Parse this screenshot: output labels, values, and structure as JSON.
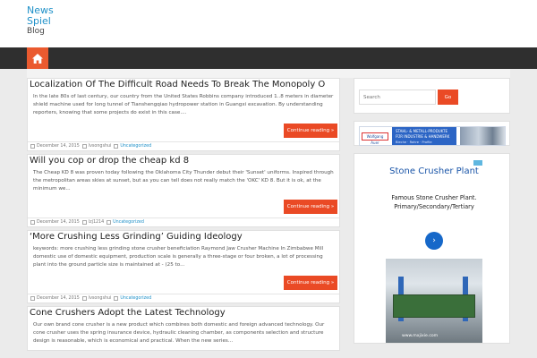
{
  "site": {
    "title_line1": "News",
    "title_line2": "Spiel",
    "tagline": "Blog"
  },
  "colors": {
    "accent": "#ea4a25",
    "link": "#1e90c8",
    "nav_bg": "#2f2f2f",
    "page_bg": "#ebebeb"
  },
  "nav": {
    "home_icon": "home-icon"
  },
  "posts": [
    {
      "title": "Localization Of The Difficult Road Needs To Break The Monopoly O",
      "excerpt": "In the late 80s of last century, our country from the United States Robbins company introduced 1..8 meters in diameter shield machine used for long tunnel of Tianshengqiao hydropower station in Guangxi excavation. By understanding reporters, knowing that some projects do exist in this case....",
      "read_more": "Continue reading »",
      "date": "December 14, 2015",
      "author": "lvsongshui",
      "category": "Uncategorized"
    },
    {
      "title": "Will you cop or drop the cheap kd 8",
      "excerpt": "The Cheap KD 8 was proven today following the Oklahoma City Thunder debut their 'Sunset' uniforms. Inspired through the metropolitan areas skies at sunset, but as you can tell does not really match the 'OKC' KD 8. But it is ok, at the minimum we...",
      "read_more": "Continue reading »",
      "date": "December 14, 2015",
      "author": "lzj1214",
      "category": "Uncategorized"
    },
    {
      "title": "‘More Crushing Less Grinding’ Guiding Ideology",
      "excerpt": "keywords: more crushing less grinding stone crusher beneficiation Raymond Jaw Crusher Machine In Zimbabwe Mill domestic use of domestic equipment, production scale is generally a three-stage or four broken, a lot of processing plant into the ground particle size is maintained at - (25 to...",
      "read_more": "Continue reading »",
      "date": "December 14, 2015",
      "author": "lvsongshui",
      "category": "Uncategorized"
    },
    {
      "title": "Cone Crushers Adopt the Latest Technology",
      "excerpt": "Our own brand cone crusher is a new product which combines both domestic and foreign advanced technology. Our cone crusher uses the spring insurance device, hydraulic cleaning chamber, as components selection and structure design is reasonable, which is economical and practical. When the new series..."
    }
  ],
  "sidebar": {
    "search_placeholder": "Search",
    "search_button": "Go",
    "banner": {
      "logo": "Wolfgang Auer",
      "line1": "STAHL- & METALL-PRODUKTE",
      "line2": "FÜR INDUSTRIE & HANDWERK",
      "line3": "Bleche · Rohre · Profile"
    },
    "ad": {
      "title": "Stone Crusher Plant",
      "text": "Famous Stone Crusher Plant. Primary/Secondary/Tertiary",
      "next": "›",
      "stamp": "www.mxjixie.com"
    }
  }
}
